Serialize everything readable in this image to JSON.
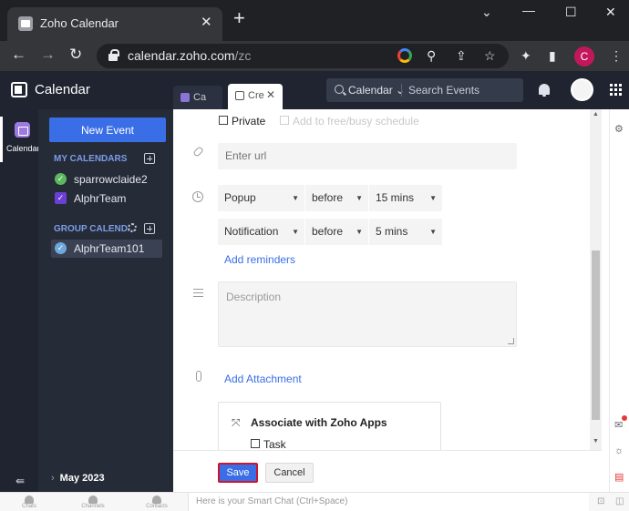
{
  "browser": {
    "tab_title": "Zoho Calendar",
    "tab_close": "✕",
    "new_tab": "+",
    "url_main": "calendar.zoho.com",
    "url_rest": "/zc",
    "profile_initial": "C",
    "window_controls": {
      "minimize": "⌄",
      "restore": "—",
      "maximize": "☐",
      "close": "✕"
    }
  },
  "app": {
    "title": "Calendar",
    "tabs": [
      {
        "label": "Ca",
        "icon": "calendar-icon"
      },
      {
        "label": "Cre",
        "icon": "create-event-icon",
        "close": "✕"
      }
    ],
    "search": {
      "scope": "Calendar ⌄",
      "placeholder": "Search Events"
    }
  },
  "rail": {
    "calendar_label": "Calendar"
  },
  "sidebar": {
    "new_event": "New Event",
    "my_calendars_title": "MY CALENDARS",
    "my_calendars": [
      {
        "name": "sparrowclaide2",
        "color": "#5cb85c"
      },
      {
        "name": "AlphrTeam",
        "color": "#6a3fd6"
      }
    ],
    "group_title": "GROUP CALEND...",
    "group_calendars": [
      {
        "name": "AlphrTeam101",
        "color": "#6fa8dc"
      }
    ],
    "month": "May 2023",
    "collapse_icon": "collapse-sidebar-icon"
  },
  "form": {
    "private_label": "Private",
    "freebusy_label": "Add to free/busy schedule",
    "url_placeholder": "Enter url",
    "reminders": [
      {
        "type": "Popup",
        "when": "before",
        "duration": "15 mins"
      },
      {
        "type": "Notification",
        "when": "before",
        "duration": "5 mins"
      }
    ],
    "add_reminders": "Add reminders",
    "description_placeholder": "Description",
    "add_attachment": "Add Attachment",
    "associate_title": "Associate with Zoho Apps",
    "task_label": "Task",
    "save": "Save",
    "cancel": "Cancel"
  },
  "bottom": {
    "smart_chat_placeholder": "Here is your Smart Chat (Ctrl+Space)",
    "items": [
      "Chats",
      "Channels",
      "Contacts"
    ]
  },
  "colors": {
    "accent": "#3a6ee6",
    "sidebar_bg": "#262b38",
    "header_bg": "#1f2430",
    "save_outline": "#d0142c"
  }
}
